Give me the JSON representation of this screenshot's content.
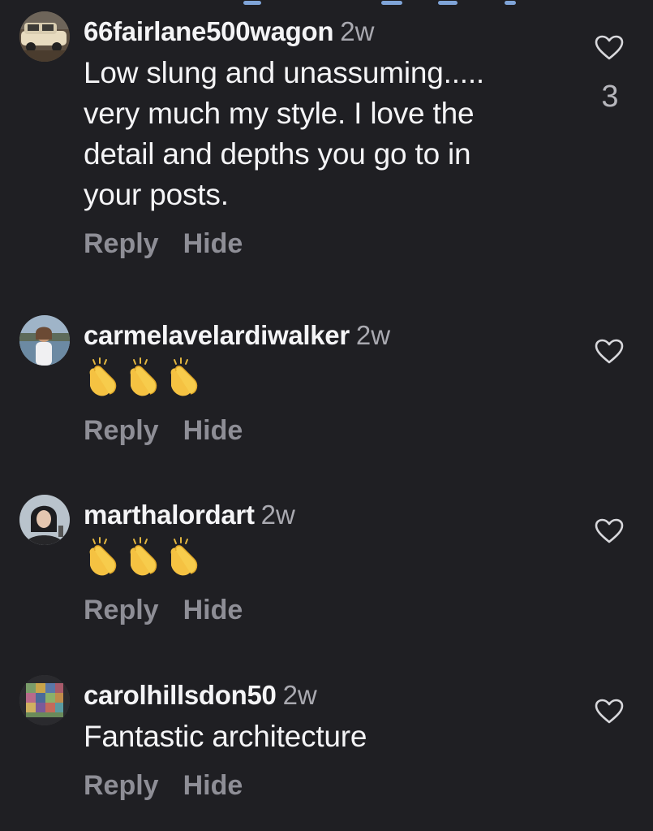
{
  "comments": [
    {
      "username": "66fairlane500wagon",
      "time": "2w",
      "text": [
        "Low slung and unassuming.....",
        "very much my style.  I love the",
        "detail and depths you go to in",
        "your posts."
      ],
      "reply_label": "Reply",
      "hide_label": "Hide",
      "like_count": "3",
      "avatar": "vintage-car-photo"
    },
    {
      "username": "carmelavelardiwalker",
      "time": "2w",
      "emoji": [
        "👏",
        "👏",
        "👏"
      ],
      "reply_label": "Reply",
      "hide_label": "Hide",
      "avatar": "person-at-lake-photo"
    },
    {
      "username": "marthalordart",
      "time": "2w",
      "emoji": [
        "👏",
        "👏",
        "👏"
      ],
      "reply_label": "Reply",
      "hide_label": "Hide",
      "avatar": "person-portrait-photo"
    },
    {
      "username": "carolhillsdon50",
      "time": "2w",
      "text": [
        "Fantastic architecture"
      ],
      "reply_label": "Reply",
      "hide_label": "Hide",
      "avatar": "colorful-quilt-photo"
    }
  ],
  "colors": {
    "background": "#1f1f23",
    "text": "#f4f4f6",
    "secondary_text": "#a9a9b0",
    "action_text": "#8e8e96",
    "icon": "#d8d8dc"
  }
}
